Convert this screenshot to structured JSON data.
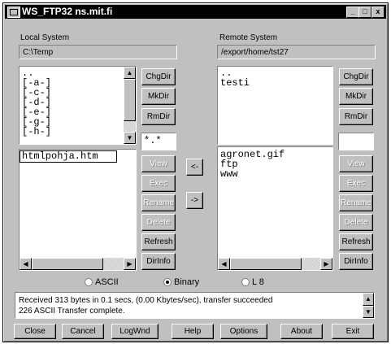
{
  "window": {
    "title": "WS_FTP32 ns.mit.fi",
    "minimize": "_",
    "maximize": "□",
    "close": "x"
  },
  "local": {
    "label": "Local System",
    "path": "C:\\Temp",
    "dirs": [
      "..",
      "[-a-]",
      "[-c-]",
      "[-d-]",
      "[-e-]",
      "[-g-]",
      "[-h-]"
    ],
    "files": [
      "htmlpohja.htm"
    ],
    "filter": "*.*",
    "buttons": {
      "chgdir": "ChgDir",
      "mkdir": "MkDir",
      "rmdir": "RmDir",
      "view": "View",
      "exec": "Exec",
      "rename": "Rename",
      "delete": "Delete",
      "refresh": "Refresh",
      "dirinfo": "DirInfo"
    }
  },
  "remote": {
    "label": "Remote System",
    "path": "/export/home/tst27",
    "dirs": [
      "..",
      "testi"
    ],
    "files": [
      "agronet.gif",
      "ftp",
      "www"
    ],
    "filter": "",
    "buttons": {
      "chgdir": "ChgDir",
      "mkdir": "MkDir",
      "rmdir": "RmDir",
      "view": "View",
      "exec": "Exec",
      "rename": "Rename",
      "delete": "Delete",
      "refresh": "Refresh",
      "dirinfo": "DirInfo"
    }
  },
  "transfer": {
    "to_local": "<-",
    "to_remote": "->"
  },
  "mode": {
    "ascii": "ASCII",
    "binary": "Binary",
    "l8": "L 8",
    "selected": "binary"
  },
  "status": {
    "line1": "Received 313 bytes in 0.1 secs, (0.00 Kbytes/sec), transfer succeeded",
    "line2": "226 ASCII Transfer complete."
  },
  "bottom": {
    "close": "Close",
    "cancel": "Cancel",
    "logwnd": "LogWnd",
    "help": "Help",
    "options": "Options",
    "about": "About",
    "exit": "Exit"
  }
}
